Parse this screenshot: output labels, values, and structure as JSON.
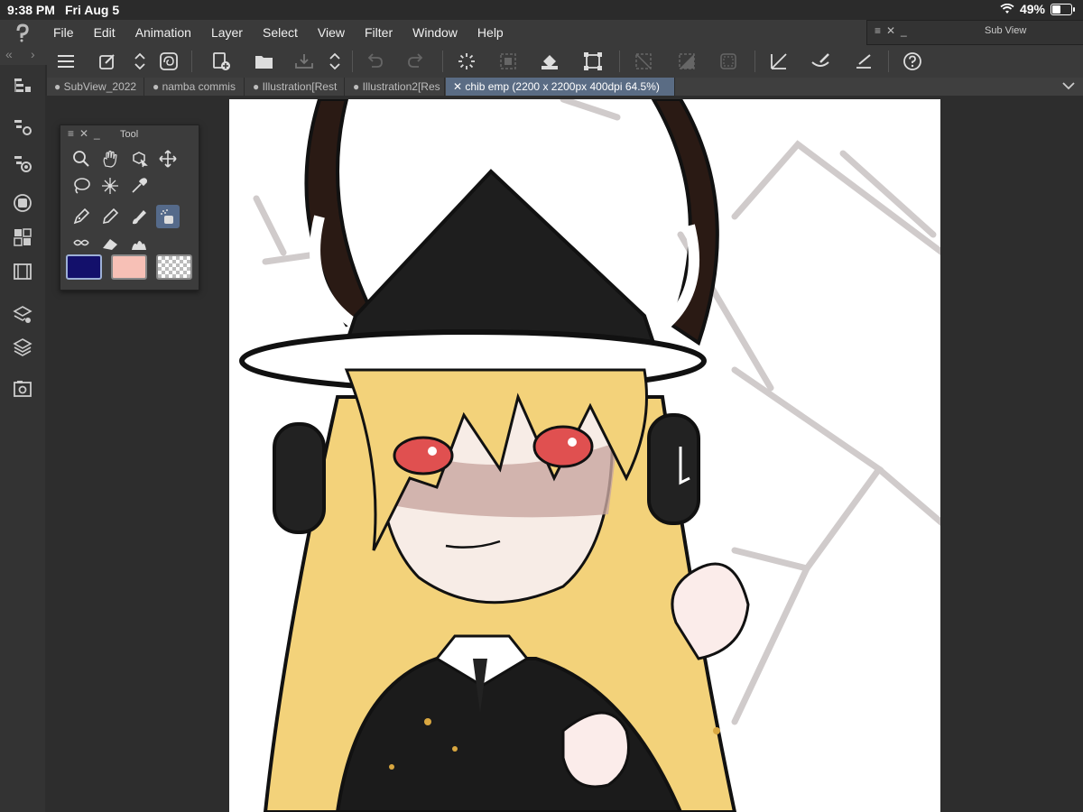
{
  "status": {
    "time": "9:38 PM",
    "date": "Fri Aug 5",
    "battery": "49%"
  },
  "menu": [
    "File",
    "Edit",
    "Animation",
    "Layer",
    "Select",
    "View",
    "Filter",
    "Window",
    "Help"
  ],
  "tabs": [
    {
      "label": "● SubView_2022",
      "active": false
    },
    {
      "label": "● namba commis",
      "active": false
    },
    {
      "label": "● Illustration[Rest",
      "active": false
    },
    {
      "label": "● Illustration2[Res",
      "active": false
    },
    {
      "label": "✕ chib emp  (2200 x 2200px 400dpi 64.5%)",
      "active": true
    }
  ],
  "tool_palette": {
    "title": "Tool",
    "main_color": "#13106b",
    "sub_color": "#f7c0b6"
  },
  "subview": {
    "title": "Sub View"
  },
  "colors": {
    "accent": "#5a6c84",
    "menubar": "#3a3a3a",
    "workspace": "#2d2d2d"
  }
}
